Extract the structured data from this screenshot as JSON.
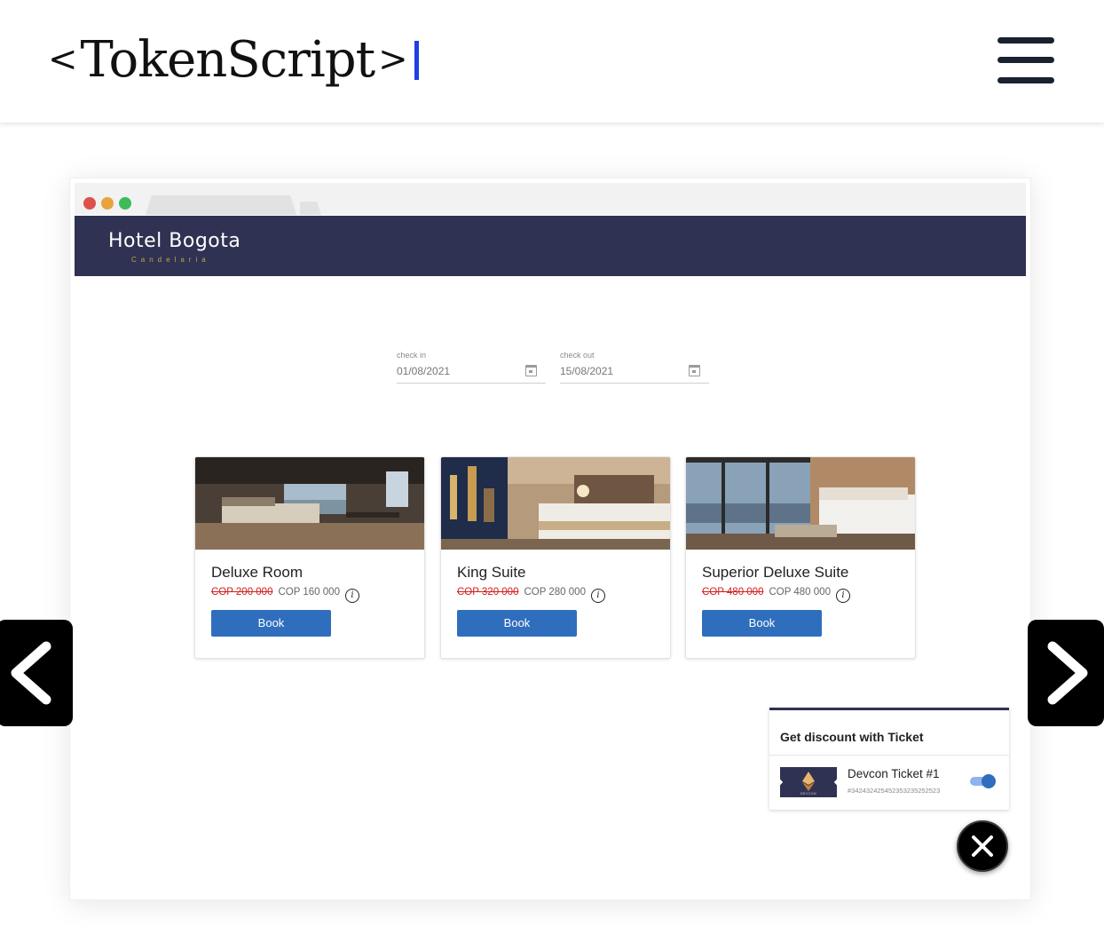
{
  "site": {
    "logo_open": "<",
    "logo_text": "TokenScript",
    "logo_close": ">"
  },
  "browser": {
    "hotel_name": "Hotel Bogota",
    "hotel_subtitle": "Candelaria",
    "checkin": {
      "label": "check in",
      "value": "01/08/2021"
    },
    "checkout": {
      "label": "check out",
      "value": "15/08/2021"
    },
    "rooms": [
      {
        "name": "Deluxe Room",
        "old_price": "COP 200 000",
        "new_price": "COP 160 000",
        "button": "Book"
      },
      {
        "name": "King Suite",
        "old_price": "COP 320 000",
        "new_price": "COP 280 000",
        "button": "Book"
      },
      {
        "name": "Superior Deluxe Suite",
        "old_price": "COP 480 000",
        "new_price": "COP 480 000",
        "button": "Book"
      }
    ],
    "discount": {
      "title": "Get discount with Ticket",
      "ticket_name": "Devcon Ticket #1",
      "ticket_id": "#342432425452353235252523",
      "ticket_logo_text": "DEVCON",
      "toggle_on": true
    }
  },
  "icons": {
    "menu": "hamburger-menu-icon",
    "prev": "chevron-left-icon",
    "next": "chevron-right-icon",
    "close": "close-icon",
    "calendar": "calendar-icon",
    "info": "info-icon"
  },
  "colors": {
    "hotel_header": "#2f3252",
    "book_button": "#2f6ebd",
    "old_price": "#d11f1f",
    "logo_cursor": "#1f3ee6"
  }
}
